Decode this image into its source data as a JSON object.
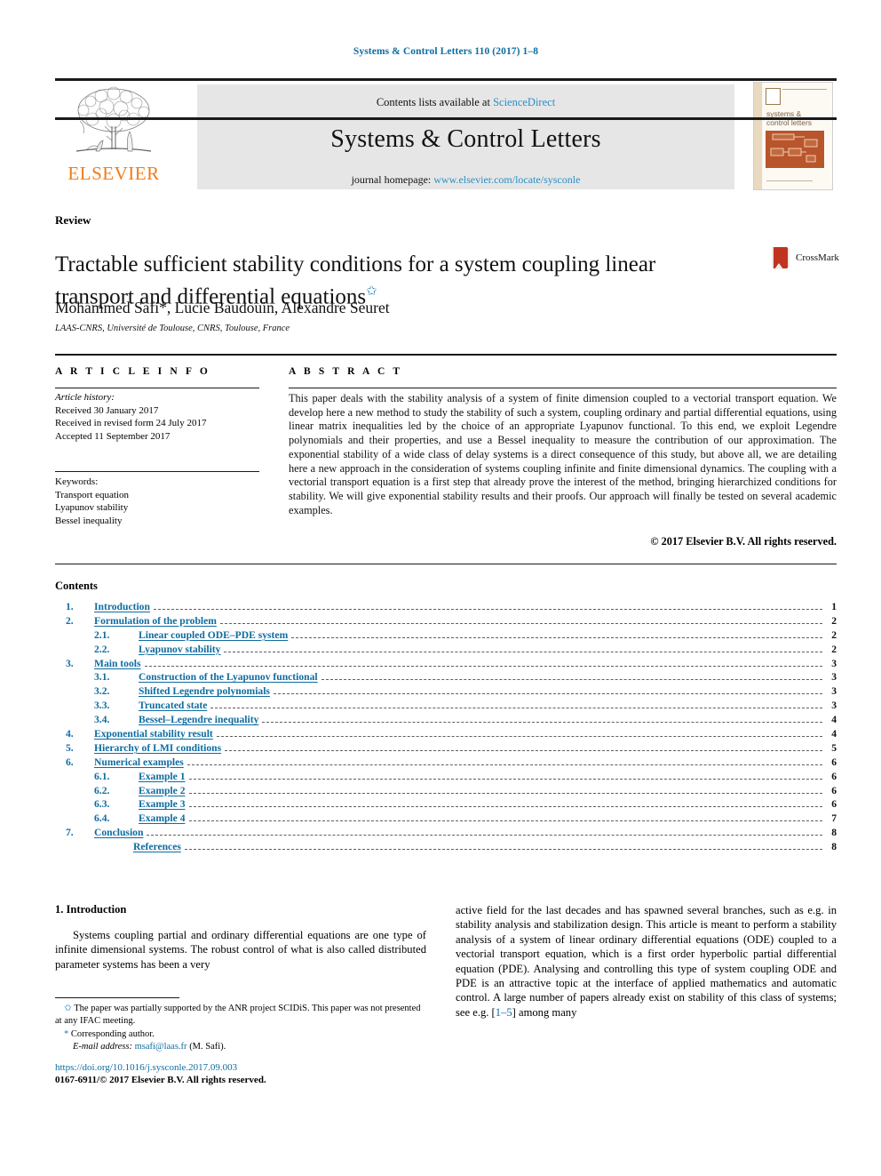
{
  "running_head": "Systems & Control Letters 110 (2017) 1–8",
  "masthead": {
    "publisher": "ELSEVIER",
    "contents_prefix": "Contents lists available at ",
    "contents_link": "ScienceDirect",
    "journal_title": "Systems & Control Letters",
    "homepage_prefix": "journal homepage: ",
    "homepage_link": "www.elsevier.com/locate/sysconle",
    "cover_title_line1": "systems &",
    "cover_title_line2": "control letters"
  },
  "article": {
    "type_label": "Review",
    "title": "Tractable sufficient stability conditions for a system coupling linear transport and differential equations",
    "title_marker": "✩",
    "authors": "Mohammed Safi*, Lucie Baudouin, Alexandre Seuret",
    "affiliation": "LAAS-CNRS, Université de Toulouse, CNRS, Toulouse, France",
    "crossmark_label": "CrossMark"
  },
  "article_info": {
    "heading": "A R T I C L E   I N F O",
    "history_label": "Article history:",
    "history": [
      "Received 30 January 2017",
      "Received in revised form 24 July 2017",
      "Accepted 11 September 2017"
    ],
    "keywords_label": "Keywords:",
    "keywords": [
      "Transport equation",
      "Lyapunov stability",
      "Bessel inequality"
    ]
  },
  "abstract": {
    "heading": "A B S T R A C T",
    "text": "This paper deals with the stability analysis of a system of finite dimension coupled to a vectorial transport equation. We develop here a new method to study the stability of such a system, coupling ordinary and partial differential equations, using linear matrix inequalities led by the choice of an appropriate Lyapunov functional. To this end, we exploit Legendre polynomials and their properties, and use a Bessel inequality to measure the contribution of our approximation. The exponential stability of a wide class of delay systems is a direct consequence of this study, but above all, we are detailing here a new approach in the consideration of systems coupling infinite and finite dimensional dynamics. The coupling with a vectorial transport equation is a first step that already prove the interest of the method, bringing hierarchized conditions for stability. We will give exponential stability results and their proofs. Our approach will finally be tested on several academic examples.",
    "copyright": "© 2017 Elsevier B.V. All rights reserved."
  },
  "contents": {
    "heading": "Contents",
    "entries": [
      {
        "num": "1.",
        "level": 1,
        "label": "Introduction",
        "page": "1"
      },
      {
        "num": "2.",
        "level": 1,
        "label": "Formulation of the problem",
        "page": "2"
      },
      {
        "num": "2.1.",
        "level": 2,
        "label": "Linear coupled ODE–PDE system",
        "page": "2"
      },
      {
        "num": "2.2.",
        "level": 2,
        "label": "Lyapunov stability",
        "page": "2"
      },
      {
        "num": "3.",
        "level": 1,
        "label": "Main tools",
        "page": "3"
      },
      {
        "num": "3.1.",
        "level": 2,
        "label": "Construction of the Lyapunov functional",
        "page": "3"
      },
      {
        "num": "3.2.",
        "level": 2,
        "label": "Shifted Legendre polynomials",
        "page": "3"
      },
      {
        "num": "3.3.",
        "level": 2,
        "label": "Truncated state",
        "page": "3"
      },
      {
        "num": "3.4.",
        "level": 2,
        "label": "Bessel–Legendre inequality",
        "page": "4"
      },
      {
        "num": "4.",
        "level": 1,
        "label": "Exponential stability result",
        "page": "4"
      },
      {
        "num": "5.",
        "level": 1,
        "label": "Hierarchy of LMI conditions",
        "page": "5"
      },
      {
        "num": "6.",
        "level": 1,
        "label": "Numerical examples",
        "page": "6"
      },
      {
        "num": "6.1.",
        "level": 2,
        "label": "Example 1",
        "page": "6"
      },
      {
        "num": "6.2.",
        "level": 2,
        "label": "Example 2",
        "page": "6"
      },
      {
        "num": "6.3.",
        "level": 2,
        "label": "Example 3",
        "page": "6"
      },
      {
        "num": "6.4.",
        "level": 2,
        "label": "Example 4",
        "page": "7"
      },
      {
        "num": "7.",
        "level": 1,
        "label": "Conclusion",
        "page": "8"
      },
      {
        "num": "",
        "level": 0,
        "label": "References",
        "page": "8"
      }
    ]
  },
  "introduction": {
    "heading": "1. Introduction",
    "col_left": "Systems coupling partial and ordinary differential equations are one type of infinite dimensional systems. The robust control of what is also called distributed parameter systems has been a very",
    "col_right_a": "active field for the last decades and has spawned several branches, such as e.g. in stability analysis and stabilization design. This article is meant to perform a stability analysis of a system of linear ordinary differential equations (ODE) coupled to a vectorial transport equation, which is a first order hyperbolic partial differential equation (PDE). Analysing and controlling this type of system coupling ODE and PDE is an attractive topic at the interface of applied mathematics and automatic control. A large number of papers already exist on stability of this class of systems; see e.g. [",
    "col_right_ref": "1–5",
    "col_right_b": "] among many"
  },
  "footnotes": {
    "marker_star": "✩",
    "note_funding": "The paper was partially supported by the ANR project SCIDiS. This paper was not presented at any IFAC meeting.",
    "marker_corr": "*",
    "note_corresponding": "Corresponding author.",
    "email_label": "E-mail address:",
    "email": "msafi@laas.fr",
    "email_suffix": "(M. Safi).",
    "doi": "https://doi.org/10.1016/j.sysconle.2017.09.003",
    "issn": "0167-6911/© 2017 Elsevier B.V. All rights reserved."
  },
  "colors": {
    "link": "#0e6ca0",
    "accent": "#2b8fc4",
    "elsevier_orange": "#f07c19",
    "masthead_bg": "#e6e6e6"
  }
}
